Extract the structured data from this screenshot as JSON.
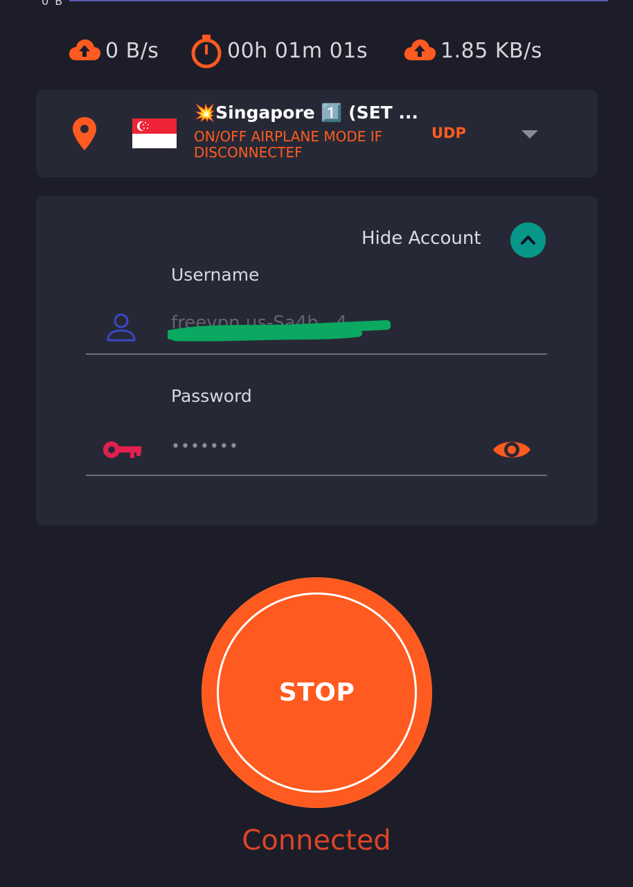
{
  "top_strip": {
    "clipped_text": "0 B"
  },
  "stats": {
    "download_speed": "0 B/s",
    "elapsed_time": "00h 01m 01s",
    "upload_speed": "1.85 KB/s"
  },
  "server": {
    "name": "💥Singapore 1️⃣ (SET ...",
    "note": "ON/OFF AIRPLANE MODE IF DISCONNECTEF",
    "protocol": "UDP",
    "country_flag": "singapore-flag-icon"
  },
  "account": {
    "toggle_label": "Hide Account",
    "username_label": "Username",
    "username_value": "freevpn.us-Sa4b...4",
    "password_label": "Password",
    "password_value": "•••••••"
  },
  "connect_button": {
    "label": "STOP"
  },
  "status_text": "Connected",
  "colors": {
    "background": "#1c1d29",
    "card": "#272836",
    "accent": "#ff5a1f",
    "teal": "#07978a",
    "user_icon": "#3b47c4",
    "key_icon": "#e0204f",
    "status": "#dc4526",
    "redaction": "#0aa860"
  },
  "icons": {
    "download": "cloud-upload-icon",
    "timer": "stopwatch-icon",
    "upload": "cloud-upload-icon",
    "location": "location-pin-icon",
    "dropdown": "caret-down-icon",
    "toggle": "chevron-up-icon",
    "user": "user-icon",
    "key": "key-icon",
    "visibility": "eye-icon"
  }
}
